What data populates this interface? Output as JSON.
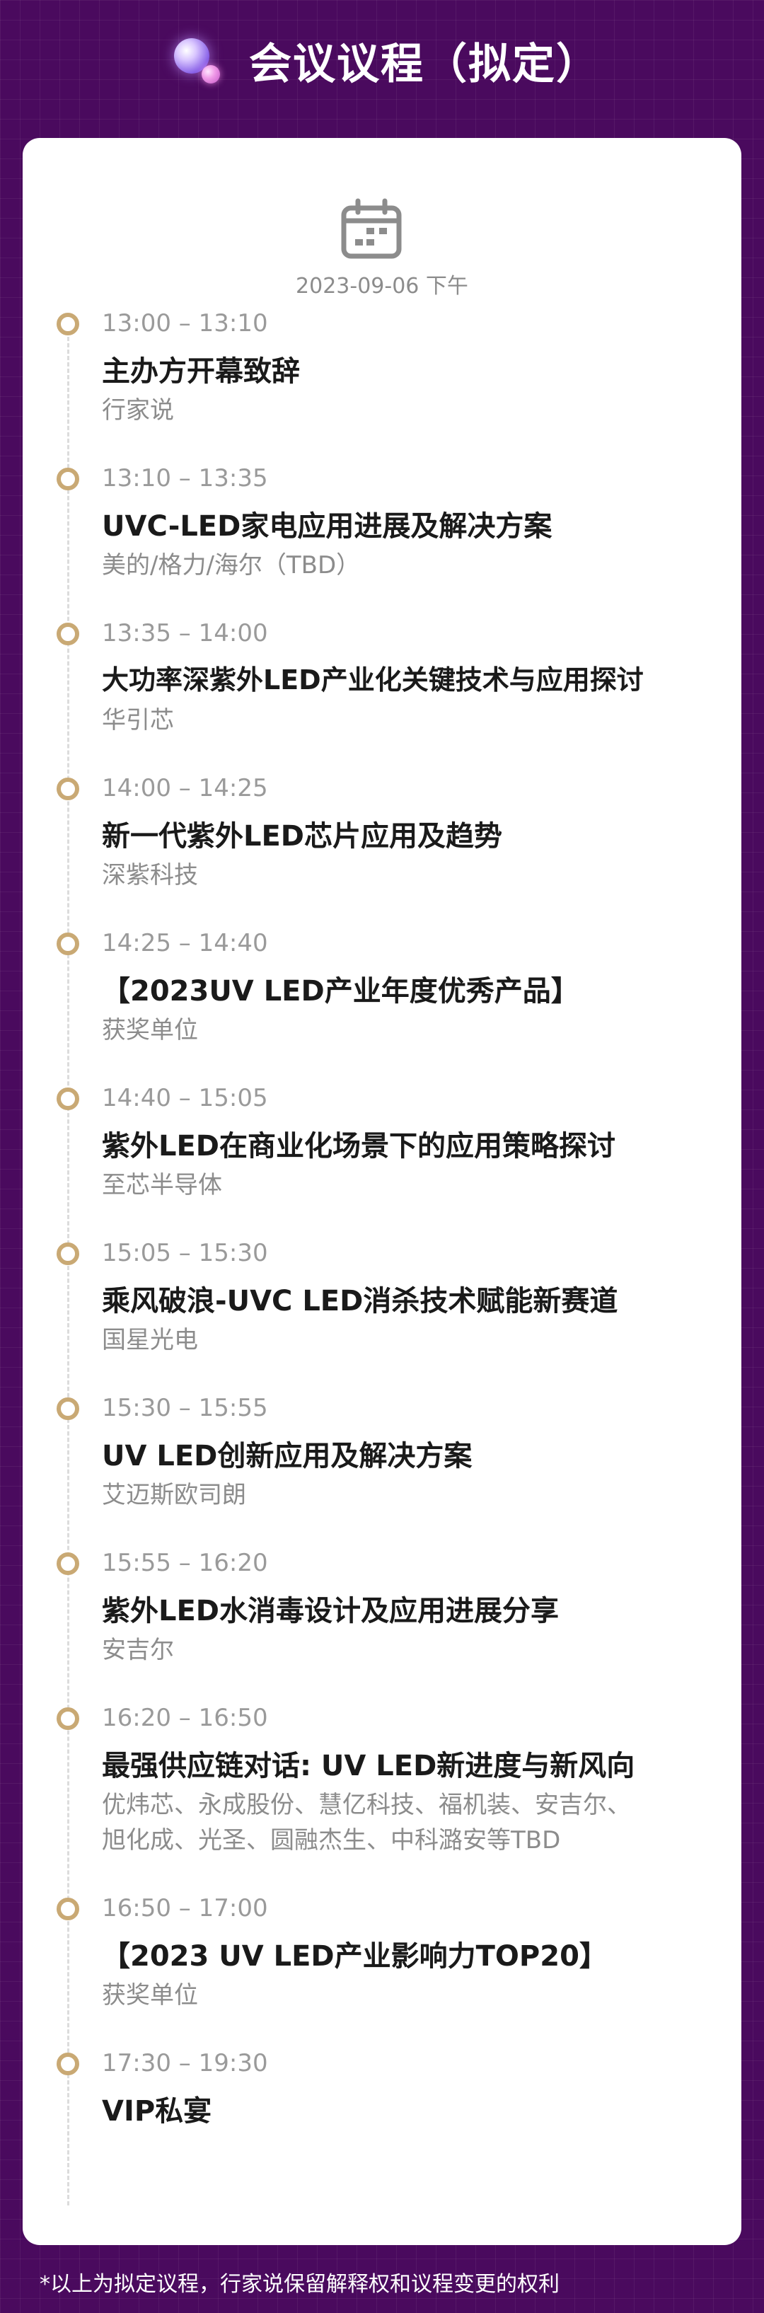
{
  "header": {
    "title": "会议议程（拟定）"
  },
  "date": "2023-09-06 下午",
  "agenda": [
    {
      "time": "13:00 – 13:10",
      "title": "主办方开幕致辞",
      "org": "行家说"
    },
    {
      "time": "13:10 – 13:35",
      "title": "UVC-LED家电应用进展及解决方案",
      "org": "美的/格力/海尔（TBD）"
    },
    {
      "time": "13:35 – 14:00",
      "title": "大功率深紫外LED产业化关键技术与应用探讨",
      "org": "华引芯"
    },
    {
      "time": "14:00 – 14:25",
      "title": "新一代紫外LED芯片应用及趋势",
      "org": "深紫科技"
    },
    {
      "time": "14:25 – 14:40",
      "title": "【2023UV LED产业年度优秀产品】",
      "org": "获奖单位"
    },
    {
      "time": "14:40 – 15:05",
      "title": "紫外LED在商业化场景下的应用策略探讨",
      "org": "至芯半导体"
    },
    {
      "time": "15:05 – 15:30",
      "title": "乘风破浪-UVC LED消杀技术赋能新赛道",
      "org": "国星光电"
    },
    {
      "time": "15:30 – 15:55",
      "title": "UV LED创新应用及解决方案",
      "org": "艾迈斯欧司朗"
    },
    {
      "time": "15:55 – 16:20",
      "title": "紫外LED水消毒设计及应用进展分享",
      "org": "安吉尔"
    },
    {
      "time": "16:20 – 16:50",
      "title": "最强供应链对话: UV LED新进度与新风向",
      "org": "优炜芯、永成股份、慧亿科技、福机装、安吉尔、",
      "org2": "旭化成、光圣、圆融杰生、中科潞安等TBD"
    },
    {
      "time": "16:50 – 17:00",
      "title": "【2023 UV LED产业影响力TOP20】",
      "org": "获奖单位"
    },
    {
      "time": "17:30 – 19:30",
      "title": "VIP私宴",
      "org": ""
    }
  ],
  "footnote": "*以上为拟定议程，行家说保留解释权和议程变更的权利",
  "colors": {
    "background": "#4a0a5e",
    "dot": "#c9a974",
    "card": "#ffffff"
  },
  "icons": {
    "calendar": "calendar-icon",
    "orb": "decorative-orb-icon"
  }
}
